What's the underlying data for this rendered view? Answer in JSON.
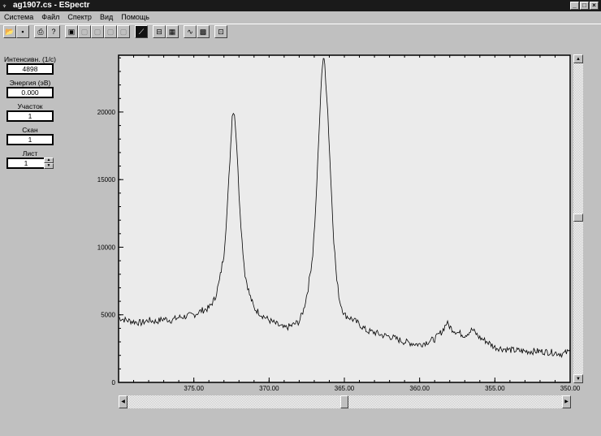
{
  "window": {
    "title": "ag1907.cs - ESpectr",
    "controls": [
      "_",
      "□",
      "×"
    ]
  },
  "menu": [
    "Система",
    "Файл",
    "Спектр",
    "Вид",
    "Помощь"
  ],
  "toolbar": [
    {
      "icon": "open-icon",
      "glyph": "📂"
    },
    {
      "icon": "save-icon",
      "glyph": "▪"
    },
    {
      "icon": "print-icon",
      "glyph": "⎙"
    },
    {
      "icon": "help-icon",
      "glyph": "?"
    },
    {
      "icon": "view1-icon",
      "glyph": "▣"
    },
    {
      "icon": "view2-icon",
      "glyph": "▢",
      "disabled": true
    },
    {
      "icon": "view3-icon",
      "glyph": "▢",
      "disabled": true
    },
    {
      "icon": "view4-icon",
      "glyph": "▢",
      "disabled": true
    },
    {
      "icon": "view5-icon",
      "glyph": "▢",
      "disabled": true
    },
    {
      "icon": "curve-icon",
      "glyph": "⟋",
      "dark": true
    },
    {
      "icon": "grid-split-icon",
      "glyph": "⊟"
    },
    {
      "icon": "grid-icon",
      "glyph": "▦"
    },
    {
      "icon": "spectrum-icon",
      "glyph": "∿"
    },
    {
      "icon": "pattern-icon",
      "glyph": "▩"
    },
    {
      "icon": "zoom-icon",
      "glyph": "⊡"
    }
  ],
  "panel": {
    "intensity": {
      "label": "Интенсивн. (1/с)",
      "value": "4898"
    },
    "energy": {
      "label": "Энергия (эВ)",
      "value": "0.000"
    },
    "section": {
      "label": "Участок",
      "value": "1"
    },
    "scan": {
      "label": "Скан",
      "value": "1"
    },
    "sheet": {
      "label": "Лист",
      "value": "1"
    }
  },
  "chart_data": {
    "type": "line",
    "title": "",
    "xlabel": "",
    "ylabel": "",
    "xlim": [
      380,
      350
    ],
    "ylim": [
      0,
      24200
    ],
    "xticks": [
      "375.00",
      "370.00",
      "365.00",
      "360.00",
      "355.00",
      "350.00"
    ],
    "xtick_values": [
      375,
      370,
      365,
      360,
      355,
      350
    ],
    "yticks": [
      "0",
      "5000",
      "10000",
      "15000",
      "20000"
    ],
    "ytick_values": [
      0,
      5000,
      10000,
      15000,
      20000
    ],
    "series": [
      {
        "name": "spectrum",
        "color": "#000000",
        "points": [
          [
            380,
            4800
          ],
          [
            379.5,
            4600
          ],
          [
            379,
            4500
          ],
          [
            378.5,
            4400
          ],
          [
            378,
            4600
          ],
          [
            377.5,
            4500
          ],
          [
            377,
            4700
          ],
          [
            376.5,
            4600
          ],
          [
            376,
            4800
          ],
          [
            375.5,
            4900
          ],
          [
            375,
            5000
          ],
          [
            374.5,
            5300
          ],
          [
            374,
            5500
          ],
          [
            373.6,
            6200
          ],
          [
            373.3,
            7500
          ],
          [
            373,
            9500
          ],
          [
            372.8,
            12500
          ],
          [
            372.6,
            16500
          ],
          [
            372.45,
            19800
          ],
          [
            372.3,
            20000
          ],
          [
            372.15,
            17500
          ],
          [
            372,
            14000
          ],
          [
            371.8,
            10500
          ],
          [
            371.6,
            8000
          ],
          [
            371.3,
            6500
          ],
          [
            371,
            5500
          ],
          [
            370.5,
            5000
          ],
          [
            370,
            4600
          ],
          [
            369.5,
            4300
          ],
          [
            369,
            4000
          ],
          [
            368.5,
            4200
          ],
          [
            368,
            4500
          ],
          [
            367.7,
            5400
          ],
          [
            367.4,
            7000
          ],
          [
            367.1,
            9500
          ],
          [
            366.9,
            13000
          ],
          [
            366.7,
            18000
          ],
          [
            366.5,
            23000
          ],
          [
            366.4,
            24000
          ],
          [
            366.3,
            23500
          ],
          [
            366.1,
            20000
          ],
          [
            365.9,
            15000
          ],
          [
            365.7,
            10500
          ],
          [
            365.5,
            7500
          ],
          [
            365.3,
            6000
          ],
          [
            365,
            5000
          ],
          [
            364.5,
            4700
          ],
          [
            364,
            4300
          ],
          [
            363.5,
            3800
          ],
          [
            363,
            3700
          ],
          [
            362.5,
            3500
          ],
          [
            362,
            3400
          ],
          [
            361.5,
            3200
          ],
          [
            361,
            3000
          ],
          [
            360.5,
            2900
          ],
          [
            360,
            2800
          ],
          [
            359.5,
            3000
          ],
          [
            359,
            3200
          ],
          [
            358.5,
            3800
          ],
          [
            358.2,
            4400
          ],
          [
            357.9,
            4000
          ],
          [
            357.5,
            3700
          ],
          [
            357,
            3500
          ],
          [
            356.5,
            3900
          ],
          [
            356,
            3300
          ],
          [
            355.5,
            3000
          ],
          [
            355,
            2600
          ],
          [
            354.5,
            2500
          ],
          [
            354,
            2400
          ],
          [
            353,
            2300
          ],
          [
            352,
            2300
          ],
          [
            351,
            2200
          ],
          [
            350.5,
            2100
          ],
          [
            350,
            2300
          ]
        ]
      }
    ],
    "grid": false,
    "legend": "none"
  }
}
